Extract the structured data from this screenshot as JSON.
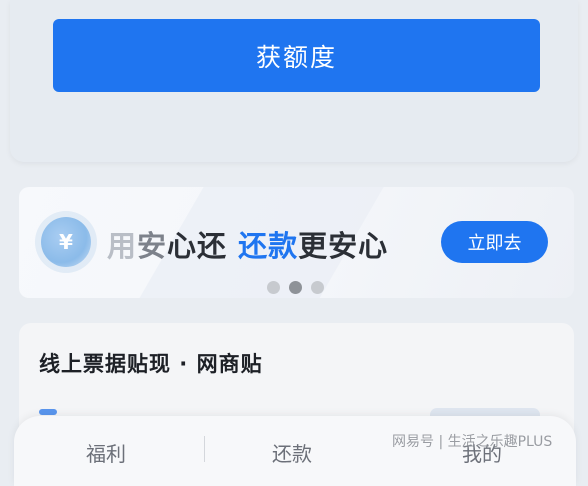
{
  "top_card": {
    "cta_label": "获额度"
  },
  "banner": {
    "coin_symbol": "¥",
    "slogan": {
      "part1": "用",
      "part2": "安",
      "part3": "心还 ",
      "highlight": "还款",
      "part4": "更安心"
    },
    "action_label": "立即去",
    "carousel": {
      "count": 3,
      "active_index": 1
    }
  },
  "bill_card": {
    "title": "线上票据贴现 · 网商贴"
  },
  "tabbar": {
    "tabs": [
      {
        "label": "福利"
      },
      {
        "label": "还款"
      },
      {
        "label": "我的"
      }
    ]
  },
  "watermark": {
    "text": "网易号 | 生活之乐趣PLUS"
  },
  "colors": {
    "accent": "#1f75f0",
    "background": "#e9edf2"
  }
}
